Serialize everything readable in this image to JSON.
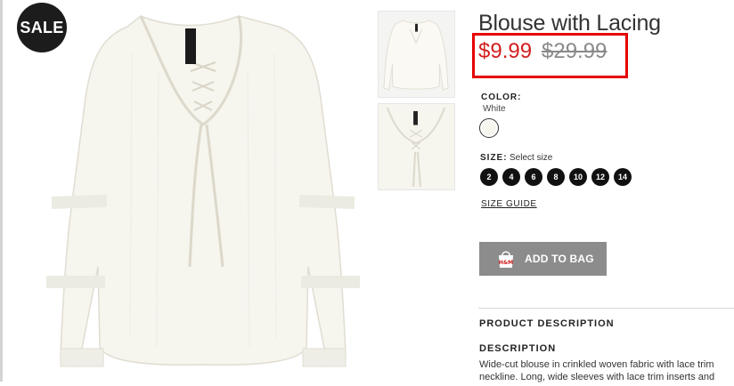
{
  "badge": {
    "label": "SALE"
  },
  "product": {
    "title": "Blouse with Lacing",
    "price_sale": "$9.99",
    "price_original": "$29.99"
  },
  "color": {
    "label": "COLOR:",
    "value": "White",
    "swatch_hex": "#f7f6ee"
  },
  "size": {
    "label": "SIZE:",
    "hint": "Select size",
    "options": [
      "2",
      "4",
      "6",
      "8",
      "10",
      "12",
      "14"
    ]
  },
  "size_guide": {
    "label": "SIZE GUIDE"
  },
  "add_to_bag": {
    "label": "ADD TO BAG",
    "icon": "shopping-bag-icon",
    "bag_text": "H&M"
  },
  "product_description": {
    "heading": "PRODUCT DESCRIPTION"
  },
  "description": {
    "heading": "DESCRIPTION",
    "line1": "Wide-cut blouse in crinkled woven fabric with lace trim",
    "line2": "neckline. Long, wide sleeves with lace trim inserts and"
  },
  "images": {
    "garment_label": "&denim"
  },
  "colors": {
    "sale_price": "#d31e1e",
    "highlight_box": "#e60000",
    "button_bg": "#8c8c8c",
    "badge_bg": "#1c1c1c"
  }
}
